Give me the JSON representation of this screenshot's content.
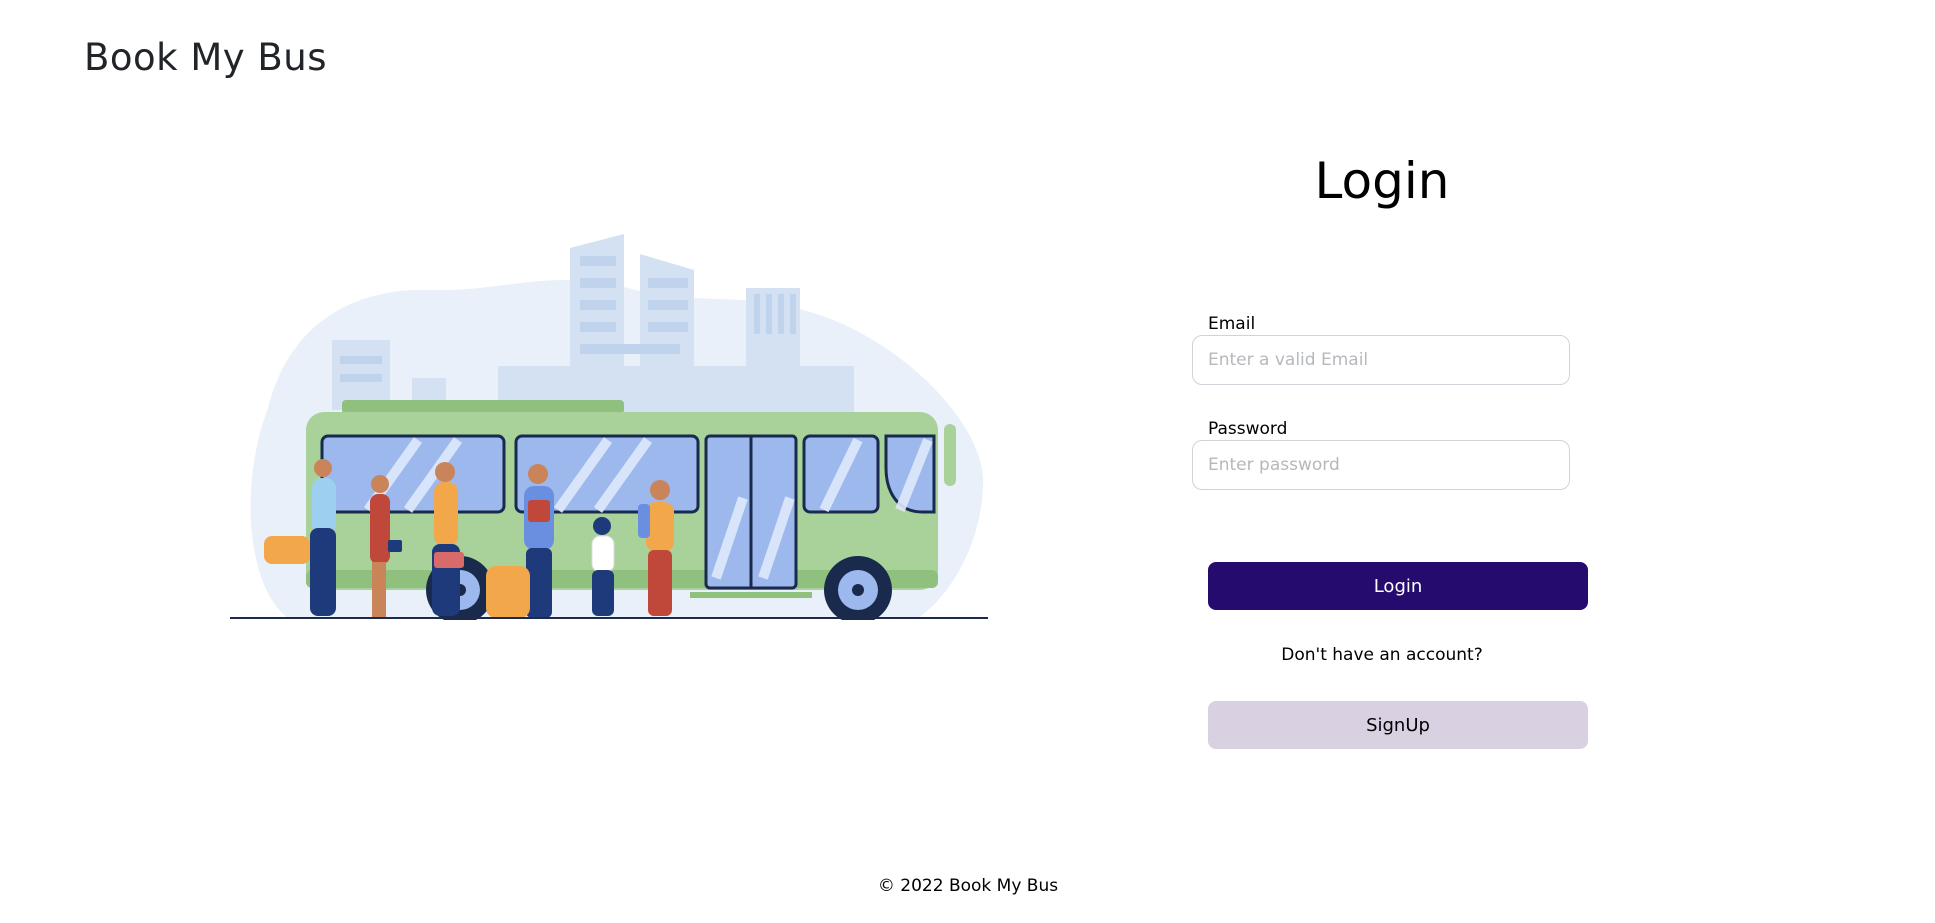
{
  "brand": {
    "title": "Book My Bus"
  },
  "illustration": {
    "icon": "bus-stop-illustration",
    "colors": {
      "bus_body": "#a8d29a",
      "bus_window": "#9cb8ec",
      "city_bg": "#dde7f5",
      "ground_line": "#1e2a4a"
    }
  },
  "login_form": {
    "title": "Login",
    "email": {
      "label": "Email",
      "value": "",
      "placeholder": "Enter a valid Email"
    },
    "password": {
      "label": "Password",
      "value": "",
      "placeholder": "Enter password"
    },
    "login_button": "Login",
    "no_account_text": "Don't have an account?",
    "signup_button": "SignUp"
  },
  "footer": {
    "copyright": "© 2022 Book My Bus"
  },
  "colors": {
    "primary": "#250b6d",
    "secondary": "#d9d0e2"
  }
}
